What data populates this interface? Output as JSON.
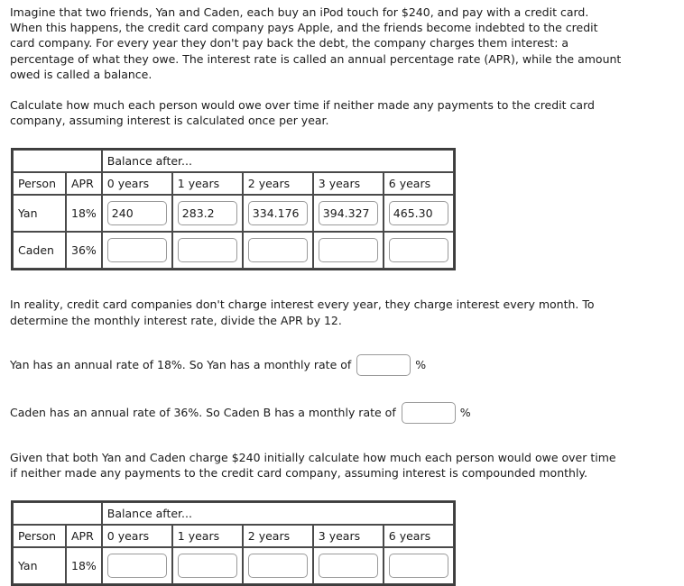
{
  "intro": {
    "paragraph1": "Imagine that two friends, Yan and Caden, each buy an iPod touch for $240, and pay with a credit card. When this happens, the credit card company pays Apple, and the friends become indebted to the credit card company. For every year they don't pay back the debt, the company charges them interest: a percentage of what they owe. The interest rate is called an annual percentage rate (APR), while the amount owed is called a balance.",
    "paragraph2": "Calculate how much each person would owe over time if neither made any payments to the credit card company, assuming interest is calculated once per year."
  },
  "table_annual": {
    "group_header": "Balance after...",
    "col_person": "Person",
    "col_apr": "APR",
    "year_headers": [
      "0 years",
      "1 years",
      "2 years",
      "3 years",
      "6 years"
    ],
    "rows": [
      {
        "person": "Yan",
        "apr": "18%",
        "values": [
          "240",
          "283.2",
          "334.176",
          "394.327",
          "465.30"
        ]
      },
      {
        "person": "Caden",
        "apr": "36%",
        "values": [
          "",
          "",
          "",
          "",
          ""
        ]
      }
    ]
  },
  "monthly": {
    "paragraph": "In reality, credit card companies don't charge interest every year, they charge interest every month. To determine the monthly interest rate, divide the APR by 12.",
    "yan_prefix": "Yan has an annual rate of 18%. So Yan has a monthly rate of",
    "yan_value": "",
    "yan_suffix": "%",
    "caden_prefix": "Caden has an annual rate of 36%. So Caden B has a monthly rate of",
    "caden_value": "",
    "caden_suffix": "%"
  },
  "compounded": {
    "paragraph": "Given that both Yan and Caden charge $240 initially calculate how much each person would owe over time if neither made any payments to the credit card company, assuming interest is compounded monthly."
  },
  "table_monthly": {
    "group_header": "Balance after...",
    "col_person": "Person",
    "col_apr": "APR",
    "year_headers": [
      "0 years",
      "1 years",
      "2 years",
      "3 years",
      "6 years"
    ],
    "rows": [
      {
        "person": "Yan",
        "apr": "18%",
        "values": [
          "",
          "",
          "",
          "",
          ""
        ]
      }
    ]
  }
}
